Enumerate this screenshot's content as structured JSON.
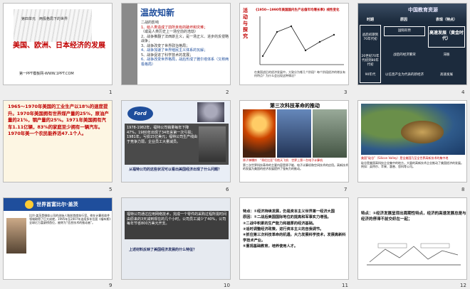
{
  "slides": [
    {
      "id": 1,
      "number": "1",
      "unit": "第四单元　两极格局下的世界",
      "title": "美国、欧洲、日本经济的发展",
      "footer": "第一PPT模板网-WWW.1PPT.COM"
    },
    {
      "id": 2,
      "number": "2",
      "heading": "温故知新",
      "subheading": "二战的影响",
      "lines": [
        "1、给人类造成了前所未有的破坏和灾难；",
        "（或是人类历史上一场空前的浩劫）",
        "2、战争推翻了法西斯主义，是一场正义、进步的反侵略战争；",
        "3、战争改变了世界政治格局；",
        "4、战争加速了世界殖民主义体系的瓦解；",
        "5、战争促进了科学技术的发展；",
        "6、战争改变世界格局，战后形成了雅尔塔体系（又称两极格局）"
      ]
    },
    {
      "id": 3,
      "number": "3",
      "vertical": "活动与探究",
      "chart_title": "《1950—1990年美国国内生产总值年均增长率》线性变化",
      "question": "在美国战后的经济发展中，大致分为哪几个阶段？每个阶段经济的增长有何特点？为什么会出现这种情况？"
    },
    {
      "id": 4,
      "number": "4",
      "logo": "中国教育资源",
      "headers": [
        "时期",
        "原因",
        "表现（特点）"
      ],
      "rows": [
        [
          "战后初期到70年代初",
          "国际形势",
          "高速发展（黄金时代）"
        ],
        [
          "20世纪70年代初到80年代初",
          "战后的经济繁荣",
          "滞胀"
        ],
        [
          "90年代",
          "以信息产业为代表的新经济",
          "高速发展"
        ]
      ]
    },
    {
      "id": 5,
      "number": "5",
      "text": "1965～1970年美国的工业生产以18%的速度提升。1970年美国拥有世界煤产量的25%，原油产量的21%，钢产量的25%。1971年美国拥有汽车1.11亿辆，83%的家庭至少拥有一辆汽车。1970年美一个农民能养活47.1个人。"
    },
    {
      "id": 6,
      "number": "6",
      "logo": "Ford",
      "text": "1978-1982年，福特公司销量每年下降47%，1980年出现了34年来第一次亏损；1981年，亏损15亿美元；福特公司生产线由于竞争力弱，企业员工大量减员。",
      "question": "从福特公司的这些状况可以看出美国经济出现了什么问题？"
    },
    {
      "id": 7,
      "number": "7",
      "title": "第三次科技革命的推动",
      "captions": "原子弹爆炸　“哥伦比亚”号航天飞机　世界上第一台电子计算机",
      "text": "第三次世界科技革命的主要内容是原子能、电子计算机和空间技术的应用。高新技术的发展为美国的经济发展提供了强有力的推动。"
    },
    {
      "id": 8,
      "number": "8",
      "caption": "美国“硅谷”（Silicon Valley）是全美国乃至全世界高新技术的集中地",
      "text": "硅谷是美国高科技企业集中的地方，大量的高新技术企业推动了美国经济的发展。例如：英特尔、苹果、惠普、思科等公司。"
    },
    {
      "id": 9,
      "number": "9",
      "header": "世界首富比尔·盖茨",
      "text": "比尔·盖茨是微软公司的创始人和前首席执行官。他在计算机软件领域取得了巨大成就，1995年至2007年连续多年位居《福布斯》全球亿万富豪榜首位，被称为“信息技术的推动者”。"
    },
    {
      "id": 10,
      "number": "10",
      "text": "福特公司通过应用网络技术，完成一个零件的采购过程所需时间由原来的3天减到现在的几个小时，公司员工减少了40%，公司每年节省800万美元开支。",
      "question": "上述材料反映了美国经济发展的什么特征？"
    },
    {
      "id": 11,
      "number": "11",
      "points": [
        "特点：①经济持续发展，仍是资本主义世界第一经济大国",
        "原因：①二战后美国国际地位的提高和军事实力增强。",
        "②二战中积累的生产能力和雄厚的经济基础。",
        "③适时调整经济政策，进行资本主义的自我调节。",
        "④抓住第三次科技革命的机遇，大力发展科学技术，发展高新科学技术产业。",
        "⑤重视基础教育，培养使用人才。"
      ]
    },
    {
      "id": 12,
      "number": "12",
      "text": "特点：①经济发展呈现出周期性特点，经济的高速发展总是与经济的停滞不前交织在一起；"
    }
  ]
}
